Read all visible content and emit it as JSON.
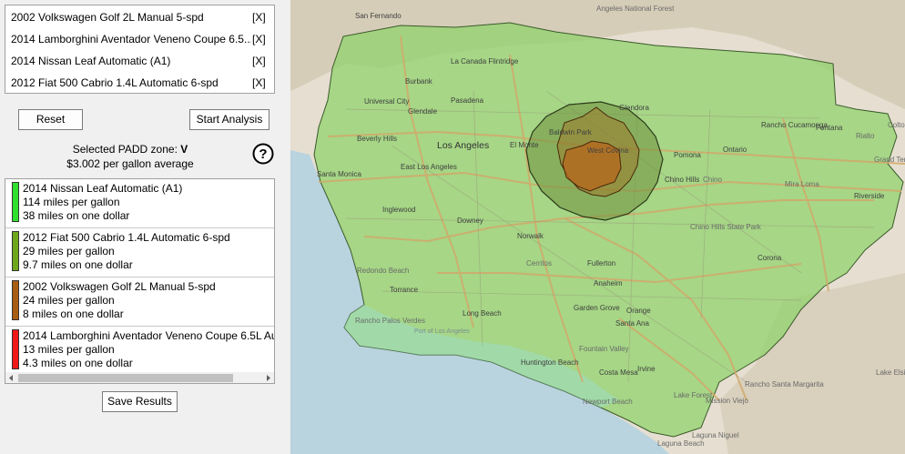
{
  "vehicles": [
    {
      "name": "2002 Volkswagen Golf 2L Manual 5-spd",
      "remove_label": "[X]"
    },
    {
      "name": "2014 Lamborghini Aventador Veneno Coupe 6.5...",
      "remove_label": "[X]"
    },
    {
      "name": "2014 Nissan Leaf Automatic (A1)",
      "remove_label": "[X]"
    },
    {
      "name": "2012 Fiat 500 Cabrio 1.4L Automatic 6-spd",
      "remove_label": "[X]"
    }
  ],
  "buttons": {
    "reset": "Reset",
    "start": "Start Analysis",
    "save": "Save Results"
  },
  "padd": {
    "label": "Selected PADD zone:",
    "zone": "V",
    "price_line": "$3.002 per gallon average"
  },
  "help_icon": "?",
  "results": [
    {
      "name": "2014 Nissan Leaf Automatic (A1)",
      "mpg": "114 miles per gallon",
      "per_dollar": "38 miles on one dollar",
      "color": "#2fe02f"
    },
    {
      "name": "2012 Fiat 500 Cabrio 1.4L Automatic 6-spd",
      "mpg": "29 miles per gallon",
      "per_dollar": "9.7 miles on one dollar",
      "color": "#6fa81c"
    },
    {
      "name": "2002 Volkswagen Golf 2L Manual 5-spd",
      "mpg": "24 miles per gallon",
      "per_dollar": "8 miles on one dollar",
      "color": "#a85d12"
    },
    {
      "name": "2014 Lamborghini Aventador Veneno Coupe 6.5L Au",
      "mpg": "13 miles per gallon",
      "per_dollar": "4.3 miles on one dollar",
      "color": "#f01818"
    }
  ],
  "map": {
    "cities": [
      "San Fernando",
      "Angeles National Forest",
      "La Canada Flintridge",
      "Burbank",
      "Pasadena",
      "Universal City",
      "Glendale",
      "Beverly Hills",
      "Los Angeles",
      "East Los Angeles",
      "El Monte",
      "Baldwin Park",
      "West Covina",
      "Glendora",
      "Santa Monica",
      "Inglewood",
      "Downey",
      "Norwalk",
      "Pomona",
      "Ontario",
      "Rancho Cucamonga",
      "Fontana",
      "Rialto",
      "Chino Hills",
      "Chino",
      "Mira Loma",
      "Riverside",
      "Chino Hills State Park",
      "Cerritos",
      "Fullerton",
      "Anaheim",
      "Corona",
      "Redondo Beach",
      "Torrance",
      "Long Beach",
      "Garden Grove",
      "Orange",
      "Santa Ana",
      "Rancho Palos Verdes",
      "Port of Los Angeles",
      "Fountain Valley",
      "Huntington Beach",
      "Costa Mesa",
      "Irvine",
      "Lake Forest",
      "Mission Viejo",
      "Rancho Santa Margarita",
      "Newport Beach",
      "Laguna Niguel",
      "Laguna Beach",
      "Lake Elsinore",
      "Grand Terrace",
      "Colton"
    ],
    "colors": {
      "land": "#e8e1d4",
      "ocean": "#b9d3df",
      "fiat": "#8ed36a",
      "golf": "#6e8f3c",
      "lambo": "#b5651d"
    }
  }
}
